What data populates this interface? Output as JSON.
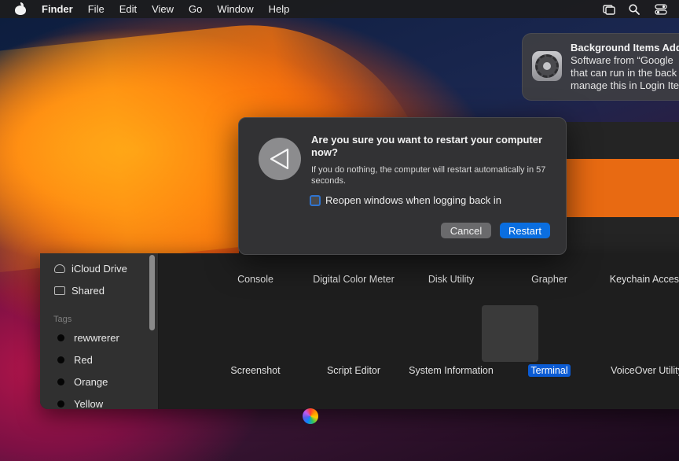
{
  "menubar": {
    "app_name": "Finder",
    "items": [
      "File",
      "Edit",
      "View",
      "Go",
      "Window",
      "Help"
    ],
    "icons": [
      "screen-mirroring-icon",
      "search-icon",
      "control-center-icon"
    ]
  },
  "notification": {
    "title": "Background Items Add",
    "body_lines": [
      "Software from “Google",
      "that can run in the back",
      "manage this in Login Ite"
    ]
  },
  "dialog": {
    "title": "Are you sure you want to restart your computer now?",
    "message": "If you do nothing, the computer will restart automatically in 57 seconds.",
    "checkbox_label": "Reopen windows when logging back in",
    "cancel_label": "Cancel",
    "restart_label": "Restart"
  },
  "sidebar": {
    "locations": [
      "iCloud Drive",
      "Shared"
    ],
    "tags_header": "Tags",
    "tags": [
      "rewwrerer",
      "Red",
      "Orange",
      "Yellow"
    ]
  },
  "apps": {
    "row1": [
      "Console",
      "Digital Color Meter",
      "Disk Utility",
      "Grapher",
      "Keychain Access"
    ],
    "row2": [
      "Screenshot",
      "Script Editor",
      "System Information",
      "Terminal",
      "VoiceOver Utility"
    ]
  },
  "colors": {
    "accent": "#0a6ee0",
    "dialog_bg": "#323234",
    "menubar_bg": "#1c1c1e"
  }
}
